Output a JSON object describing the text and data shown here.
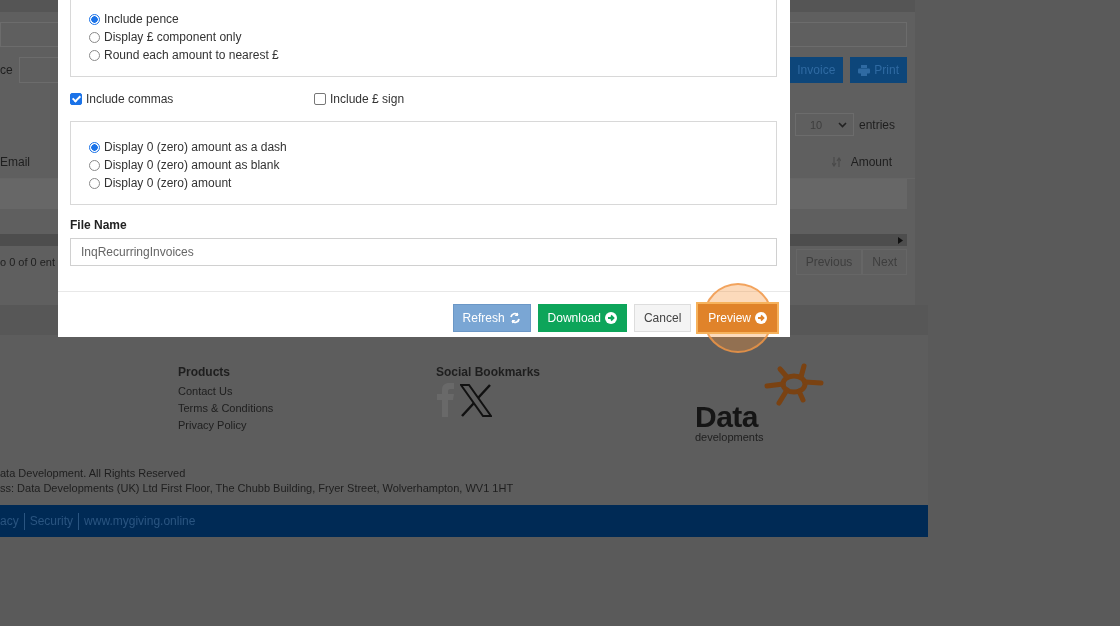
{
  "page": {
    "filter_label": "ce",
    "buttons": [
      {
        "label": "Invoice",
        "kind": "invoice"
      },
      {
        "label": "Print",
        "kind": "print"
      }
    ],
    "page_size": {
      "value": "10",
      "suffix": "entries"
    },
    "table": {
      "columns": [
        "Email",
        "Amount"
      ]
    },
    "info": "o 0 of 0 ent",
    "pagination": [
      "Previous",
      "Next"
    ]
  },
  "modal": {
    "pence_options": [
      {
        "label": "Include pence",
        "selected": true
      },
      {
        "label": "Display £ component only",
        "selected": false
      },
      {
        "label": "Round each amount to nearest £",
        "selected": false
      }
    ],
    "checkboxes": [
      {
        "label": "Include commas",
        "checked": true
      },
      {
        "label": "Include £ sign",
        "checked": false
      }
    ],
    "zero_options": [
      {
        "label": "Display 0 (zero) amount as a dash",
        "selected": true
      },
      {
        "label": "Display 0 (zero) amount as blank",
        "selected": false
      },
      {
        "label": "Display 0 (zero) amount",
        "selected": false
      }
    ],
    "file_name": {
      "label": "File Name",
      "value": "InqRecurringInvoices"
    },
    "buttons": [
      {
        "label": "Refresh",
        "kind": "refresh",
        "highlighted": false
      },
      {
        "label": "Download",
        "kind": "download",
        "highlighted": false
      },
      {
        "label": "Cancel",
        "kind": "cancel",
        "highlighted": false
      },
      {
        "label": "Preview",
        "kind": "preview",
        "highlighted": true
      }
    ]
  },
  "footer": {
    "products": {
      "title": "Products",
      "links": [
        "Contact Us",
        "Terms & Conditions",
        "Privacy Policy"
      ]
    },
    "social": {
      "title": "Social Bookmarks"
    },
    "logo": {
      "name": "Data",
      "tagline": "developments"
    },
    "copyright": [
      "ata Development. All Rights Reserved",
      "ss: Data Developments (UK) Ltd First Floor, The Chubb Building, Fryer Street, Wolverhampton, WV1 1HT"
    ],
    "bottom_links": [
      "acy",
      "Security",
      "www.mygiving.online"
    ]
  }
}
